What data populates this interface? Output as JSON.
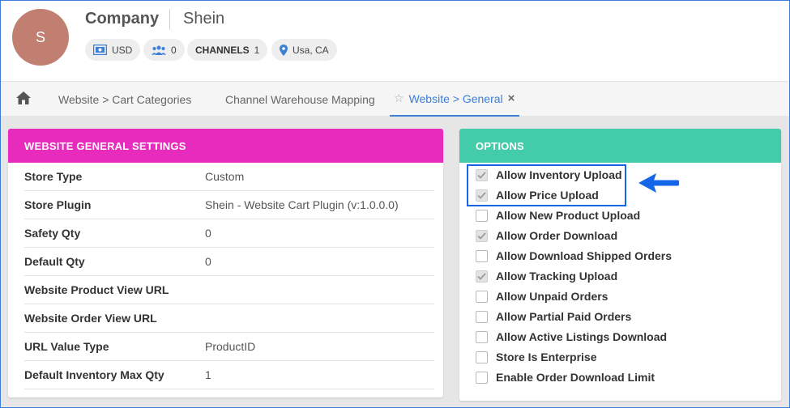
{
  "header": {
    "avatar_initial": "S",
    "company_label": "Company",
    "company_name": "Shein",
    "chips": {
      "currency": "USD",
      "users": "0",
      "channels_label": "CHANNELS",
      "channels_count": "1",
      "location": "Usa, CA"
    }
  },
  "tabs": [
    {
      "label": "Website > Cart Categories"
    },
    {
      "label": "Channel Warehouse Mapping"
    },
    {
      "label": "Website > General"
    }
  ],
  "general": {
    "title": "WEBSITE GENERAL SETTINGS",
    "accent": "#e62bbd",
    "rows": [
      {
        "label": "Store Type",
        "value": "Custom"
      },
      {
        "label": "Store Plugin",
        "value": "Shein - Website Cart Plugin (v:1.0.0.0)"
      },
      {
        "label": "Safety Qty",
        "value": "0"
      },
      {
        "label": "Default Qty",
        "value": "0"
      },
      {
        "label": "Website Product View URL",
        "value": ""
      },
      {
        "label": "Website Order View URL",
        "value": ""
      },
      {
        "label": "URL Value Type",
        "value": "ProductID"
      },
      {
        "label": "Default Inventory Max Qty",
        "value": "1"
      }
    ]
  },
  "options": {
    "title": "OPTIONS",
    "accent": "#43ccaa",
    "items": [
      {
        "label": "Allow Inventory Upload",
        "checked": true
      },
      {
        "label": "Allow Price Upload",
        "checked": true
      },
      {
        "label": "Allow New Product Upload",
        "checked": false
      },
      {
        "label": "Allow Order Download",
        "checked": true
      },
      {
        "label": "Allow Download Shipped Orders",
        "checked": false
      },
      {
        "label": "Allow Tracking Upload",
        "checked": true
      },
      {
        "label": "Allow Unpaid Orders",
        "checked": false
      },
      {
        "label": "Allow Partial Paid Orders",
        "checked": false
      },
      {
        "label": "Allow Active Listings Download",
        "checked": false
      },
      {
        "label": "Store Is Enterprise",
        "checked": false
      },
      {
        "label": "Enable Order Download Limit",
        "checked": false
      }
    ]
  },
  "colors": {
    "active_tab": "#3c7fd6",
    "annotation": "#1565e8"
  }
}
